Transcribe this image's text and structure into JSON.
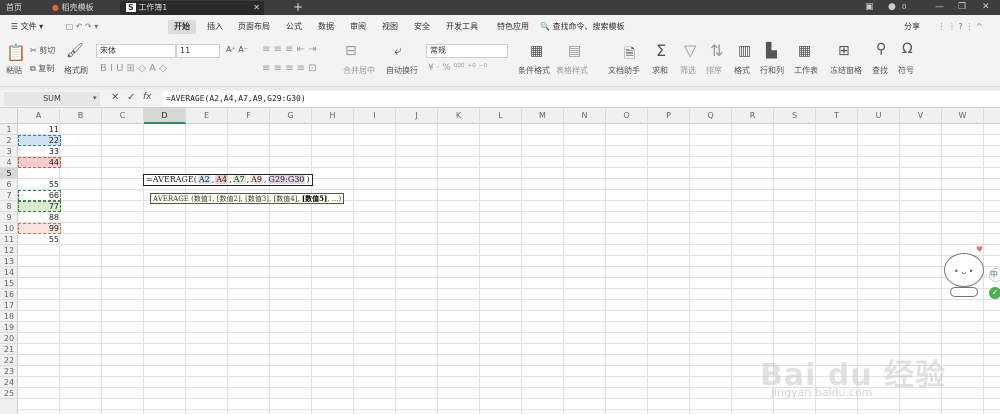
{
  "titlebar": {
    "tabs": [
      "首页",
      "稻壳模板",
      "工作簿1"
    ],
    "new_tab": "+",
    "user": "0"
  },
  "menubar": {
    "file_menu": "文件",
    "items": [
      "开始",
      "插入",
      "页面布局",
      "公式",
      "数据",
      "审阅",
      "视图",
      "安全",
      "开发工具",
      "特色应用"
    ],
    "search": "查找命令、搜索模板",
    "share": "分享"
  },
  "ribbon": {
    "paste": "粘贴",
    "cut": "剪切",
    "copy": "复制",
    "format_painter": "格式刷",
    "font_name": "宋体",
    "font_size": "11",
    "merge": "合并居中",
    "wrap": "自动换行",
    "num_format": "常规",
    "cond_format": "条件格式",
    "table_style": "表格样式",
    "doc_helper": "文档助手",
    "sum": "求和",
    "filter": "筛选",
    "sort": "排序",
    "format": "格式",
    "rowcol": "行和列",
    "worksheet": "工作表",
    "freeze": "冻结窗格",
    "find": "查找",
    "symbol": "符号"
  },
  "formula_bar": {
    "name_box": "SUM",
    "fx": "fx",
    "formula": "=AVERAGE(A2,A4,A7,A9,G29:G30)"
  },
  "columns": [
    "A",
    "B",
    "C",
    "D",
    "E",
    "F",
    "G",
    "H",
    "I",
    "J",
    "K",
    "L",
    "M",
    "N",
    "O",
    "P",
    "Q",
    "R",
    "S",
    "T",
    "U",
    "V",
    "W"
  ],
  "rows": [
    "1",
    "2",
    "3",
    "4",
    "5",
    "6",
    "7",
    "8",
    "9",
    "10",
    "11",
    "12",
    "13",
    "14",
    "15",
    "16",
    "17",
    "18",
    "19",
    "20",
    "21",
    "22",
    "23",
    "24",
    "25"
  ],
  "cells": {
    "A": [
      "11",
      "22",
      "33",
      "44",
      "55",
      "66",
      "77",
      "88",
      "99",
      "55"
    ]
  },
  "editor": {
    "prefix": "=AVERAGE(",
    "args": [
      "A2",
      ",",
      "A4",
      ",",
      "A7",
      ",",
      "A9",
      ",",
      "G29:G30"
    ],
    "suffix": ")"
  },
  "tooltip": {
    "text": "AVERAGE (数值1, [数值2], [数值3], [数值4], ",
    "bold": "[数值5]",
    "tail": ", ...)"
  },
  "colors": {
    "ref_blue": "#cfe2f3",
    "ref_red": "#f4cccc",
    "ref_green": "#d9ead3",
    "ref_purple": "#e1d5e7",
    "accent": "#2e8b57"
  },
  "watermark": {
    "brand": "Bai du 经验",
    "url": "jingyan.baidu.com"
  }
}
